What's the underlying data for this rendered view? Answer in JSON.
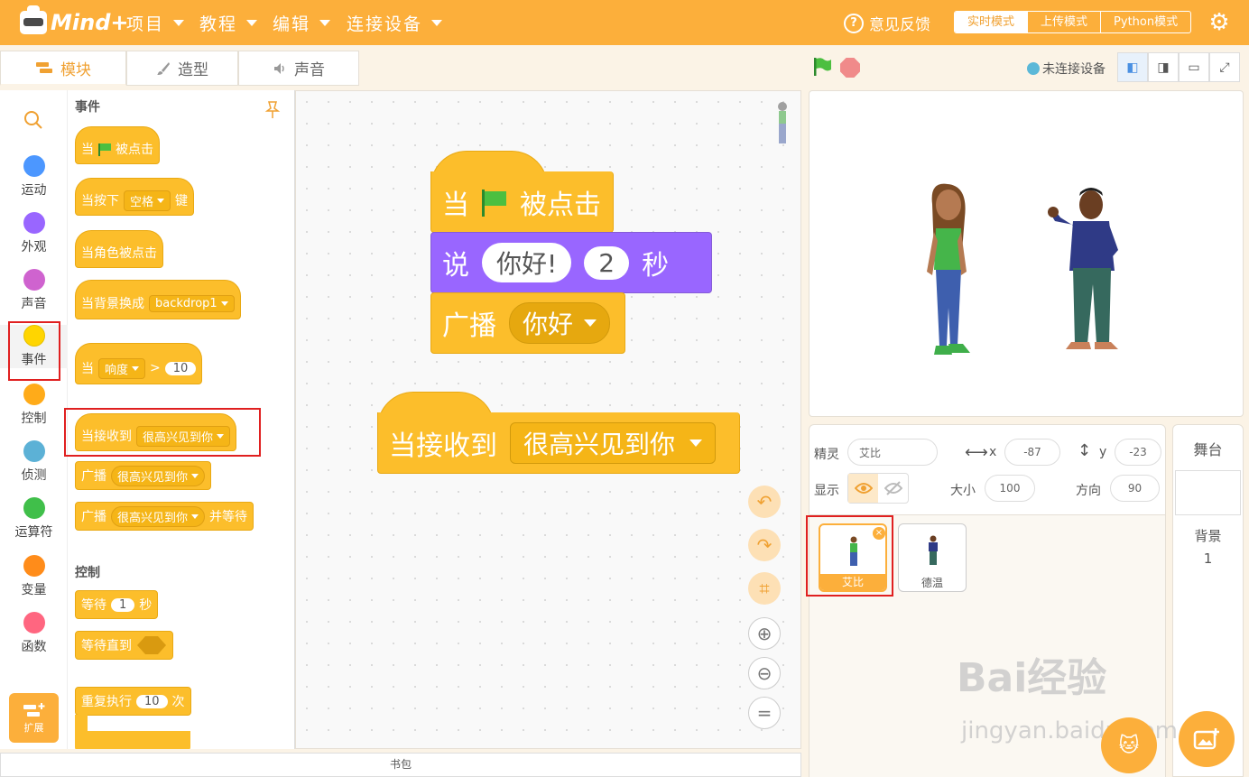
{
  "app": {
    "logo_text": "Mind+"
  },
  "menu": [
    {
      "label": "项目"
    },
    {
      "label": "教程"
    },
    {
      "label": "编辑"
    },
    {
      "label": "连接设备"
    }
  ],
  "header": {
    "feedback": "意见反馈",
    "modes": [
      "实时模式",
      "上传模式",
      "Python模式"
    ]
  },
  "tabs": {
    "blocks": "模块",
    "costumes": "造型",
    "sounds": "声音"
  },
  "categories": [
    {
      "label": "运动",
      "color": "#4c97ff"
    },
    {
      "label": "外观",
      "color": "#9966ff"
    },
    {
      "label": "声音",
      "color": "#cf63cf"
    },
    {
      "label": "事件",
      "color": "#ffd500"
    },
    {
      "label": "控制",
      "color": "#ffab19"
    },
    {
      "label": "侦测",
      "color": "#5cb1d6"
    },
    {
      "label": "运算符",
      "color": "#40bf4a"
    },
    {
      "label": "变量",
      "color": "#ff8c1a"
    },
    {
      "label": "函数",
      "color": "#ff6680"
    }
  ],
  "extension": {
    "label": "扩展"
  },
  "palette": {
    "events_title": "事件",
    "control_title": "控制",
    "b_when_flag": {
      "pre": "当",
      "post": "被点击"
    },
    "b_key": {
      "pre": "当按下",
      "key": "空格",
      "post": "键"
    },
    "b_sprite_click": "当角色被点击",
    "b_backdrop": {
      "pre": "当背景换成",
      "val": "backdrop1"
    },
    "b_loudness": {
      "pre": "当",
      "sel": "响度",
      "op": ">",
      "num": "10"
    },
    "b_receive": {
      "pre": "当接收到",
      "msg": "很高兴见到你"
    },
    "b_broadcast": {
      "pre": "广播",
      "msg": "很高兴见到你"
    },
    "b_broadcast_wait": {
      "pre": "广播",
      "msg": "很高兴见到你",
      "post": "并等待"
    },
    "b_wait": {
      "pre": "等待",
      "num": "1",
      "post": "秒"
    },
    "b_wait_until": "等待直到",
    "b_repeat": {
      "pre": "重复执行",
      "num": "10",
      "post": "次"
    }
  },
  "workspace": {
    "s1_hat": {
      "pre": "当",
      "post": "被点击"
    },
    "s1_say": {
      "pre": "说",
      "text": "你好!",
      "num": "2",
      "post": "秒"
    },
    "s1_broadcast": {
      "pre": "广播",
      "msg": "你好"
    },
    "s2_hat": {
      "pre": "当接收到",
      "msg": "很高兴见到你"
    }
  },
  "backpack": "书包",
  "stage": {
    "connection": "未连接设备"
  },
  "sprite_info": {
    "sprite_label": "精灵",
    "sprite_name": "艾比",
    "x_label": "x",
    "x": "-87",
    "y_label": "y",
    "y": "-23",
    "show_label": "显示",
    "size_label": "大小",
    "size": "100",
    "dir_label": "方向",
    "direction": "90"
  },
  "sprites": [
    {
      "name": "艾比"
    },
    {
      "name": "德温"
    }
  ],
  "stage_pane": {
    "title": "舞台",
    "backdrop_label": "背景",
    "backdrop_count": "1"
  },
  "watermark": {
    "line1": "Bai经验",
    "line2": "jingyan.baidu.com"
  }
}
